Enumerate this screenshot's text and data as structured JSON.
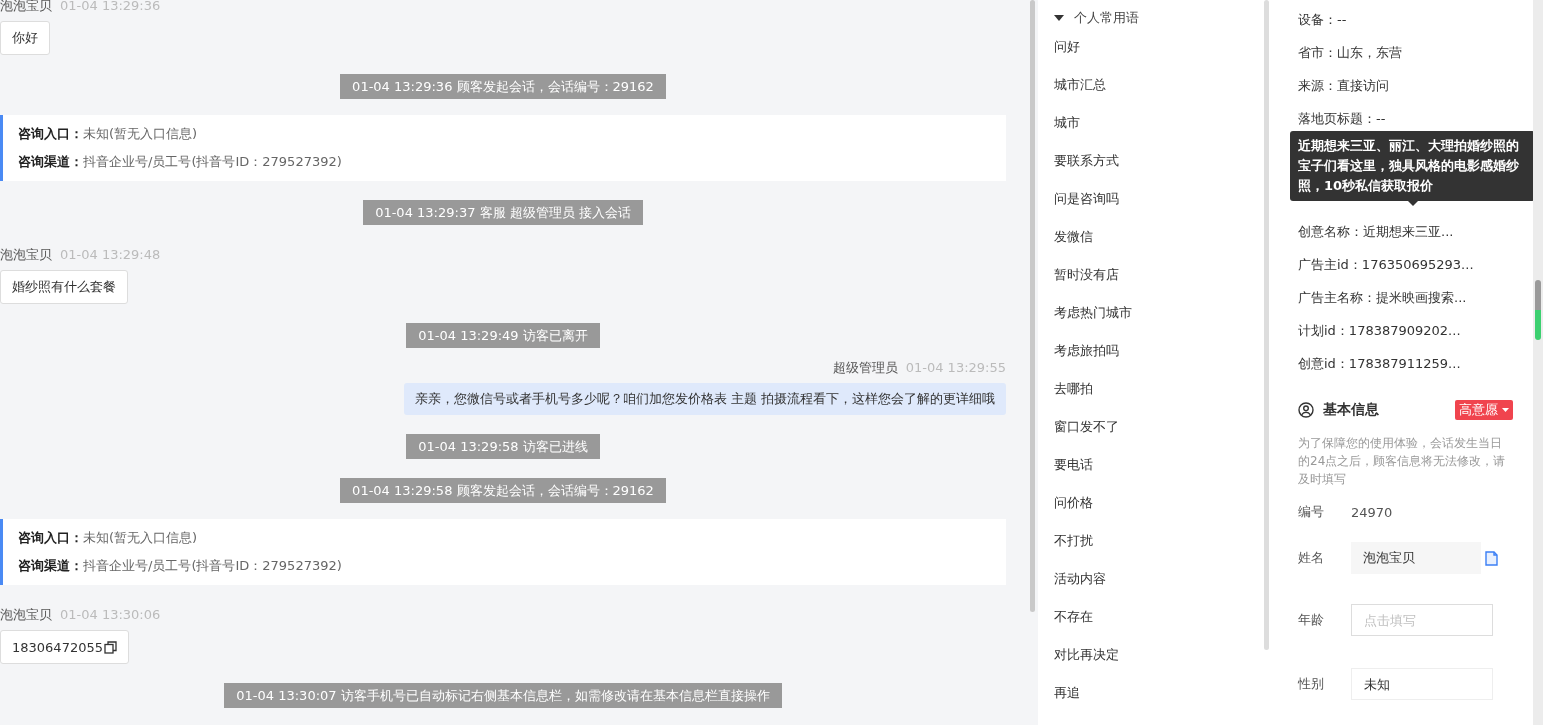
{
  "chat": {
    "messages": [
      {
        "kind": "visitor",
        "name": "泡泡宝贝",
        "time": "01-04 13:29:36",
        "text": "你好",
        "copy": false
      },
      {
        "kind": "system",
        "text": "01-04 13:29:36 顾客发起会话，会话编号：29162"
      },
      {
        "kind": "card",
        "lines": [
          {
            "label": "咨询入口：",
            "value": "未知(暂无入口信息)"
          },
          {
            "label": "咨询渠道：",
            "value": "抖音企业号/员工号(抖音号ID：279527392)"
          }
        ]
      },
      {
        "kind": "system",
        "text": "01-04 13:29:37 客服 超级管理员 接入会话"
      },
      {
        "kind": "visitor",
        "name": "泡泡宝贝",
        "time": "01-04 13:29:48",
        "text": "婚纱照有什么套餐",
        "copy": false
      },
      {
        "kind": "system",
        "text": "01-04 13:29:49 访客已离开"
      },
      {
        "kind": "agent",
        "name": "超级管理员",
        "time": "01-04 13:29:55",
        "text": "亲亲，您微信号或者手机号多少呢？咱们加您发价格表 主题 拍摄流程看下，这样您会了解的更详细哦"
      },
      {
        "kind": "system",
        "text": "01-04 13:29:58 访客已进线"
      },
      {
        "kind": "system",
        "text": "01-04 13:29:58 顾客发起会话，会话编号：29162"
      },
      {
        "kind": "card",
        "lines": [
          {
            "label": "咨询入口：",
            "value": "未知(暂无入口信息)"
          },
          {
            "label": "咨询渠道：",
            "value": "抖音企业号/员工号(抖音号ID：279527392)"
          }
        ]
      },
      {
        "kind": "visitor",
        "name": "泡泡宝贝",
        "time": "01-04 13:30:06",
        "text": "18306472055",
        "copy": true
      },
      {
        "kind": "system",
        "text": "01-04 13:30:07 访客手机号已自动标记右侧基本信息栏，如需修改请在基本信息栏直接操作"
      }
    ]
  },
  "phrases": {
    "group": {
      "label": "个人常用语",
      "expanded": true
    },
    "items": [
      "问好",
      "城市汇总",
      "城市",
      "要联系方式",
      "问是咨询吗",
      "发微信",
      "暂时没有店",
      "考虑热门城市",
      "考虑旅拍吗",
      "去哪拍",
      "窗口发不了",
      "要电话",
      "问价格",
      "不打扰",
      "活动内容",
      "不存在",
      "对比再决定",
      "再追"
    ]
  },
  "source_info": {
    "rows": [
      "设备：--",
      "省市：山东，东营",
      "来源：直接访问",
      "落地页标题：--"
    ],
    "tooltip": "近期想来三亚、丽江、大理拍婚纱照的宝子们看这里，独具风格的电影感婚纱照，10秒私信获取报价",
    "rows_below": [
      "创意名称：近期想来三亚...",
      "广告主id：176350695293...",
      "广告主名称：提米映画搜索...",
      "计划id：178387909202...",
      "创意id：178387911259..."
    ]
  },
  "basic_info": {
    "title": "基本信息",
    "intent_tag": "高意愿",
    "notice": "为了保障您的使用体验，会话发生当日的24点之后，顾客信息将无法修改，请及时填写",
    "fields": [
      {
        "kind": "text",
        "label": "编号",
        "value": "24970"
      },
      {
        "kind": "readonly",
        "label": "姓名",
        "value": "泡泡宝贝"
      },
      {
        "kind": "input",
        "label": "年龄",
        "placeholder": "点击填写"
      },
      {
        "kind": "select",
        "label": "性别",
        "value": "未知"
      }
    ]
  }
}
